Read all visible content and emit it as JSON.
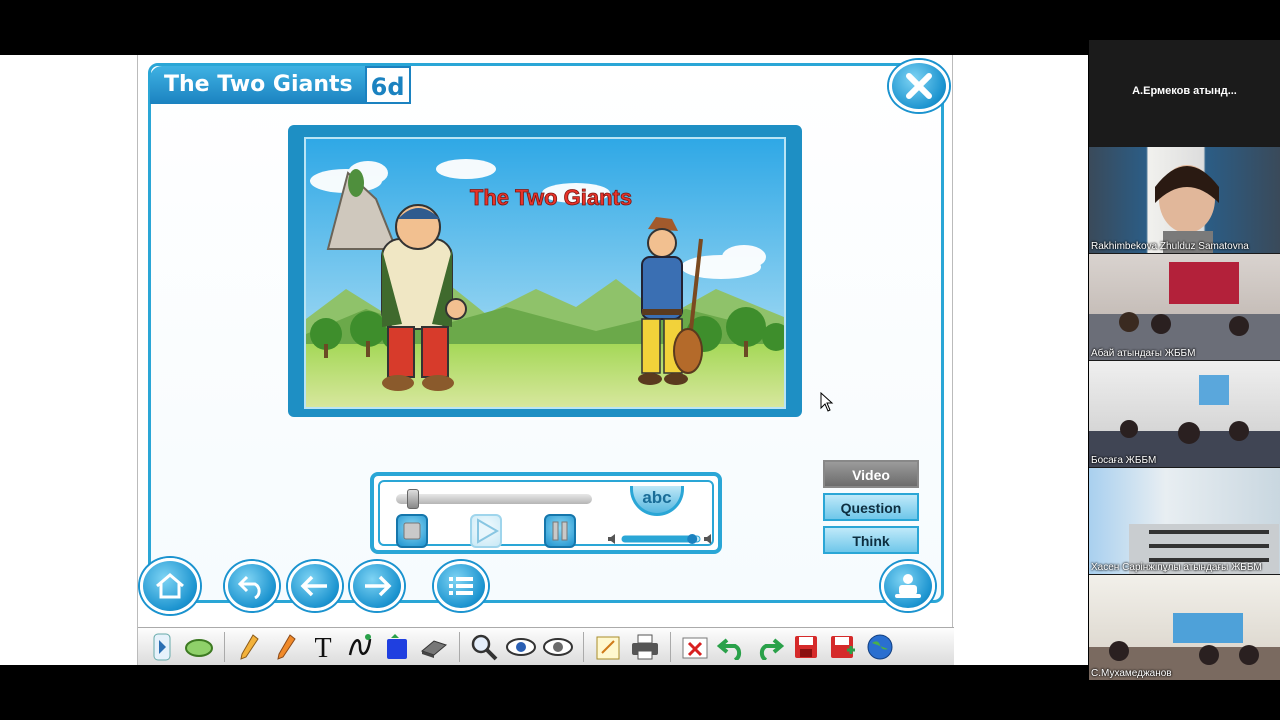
{
  "lesson": {
    "title": "The Two Giants",
    "unit": "6d"
  },
  "video": {
    "caption": "The Two Giants",
    "progress_fraction": 0.06,
    "volume_fraction": 0.9
  },
  "controls": {
    "abc_label": "abc"
  },
  "side_buttons": {
    "video": "Video",
    "question": "Question",
    "think": "Think"
  },
  "participants": {
    "host_name": "А.Ермеков  атынд...",
    "tiles": [
      {
        "label": "Rakhimbekova Zhulduz Samatovna"
      },
      {
        "label": "Абай атындағы ЖББМ"
      },
      {
        "label": "Босаға ЖББМ"
      },
      {
        "label": "Хасен Сарінжіпұлы атындағы ЖББМ"
      },
      {
        "label": "С.Мухамеджанов"
      }
    ]
  },
  "colors": {
    "accent": "#2aa6d6",
    "accent_dark": "#1b82c0",
    "title_text": "#ffffff",
    "caption_red": "#e8332a"
  },
  "icons": {
    "close": "close-icon",
    "home": "home-icon",
    "undo": "undo-icon",
    "back": "arrow-left-icon",
    "next": "arrow-right-icon",
    "list": "list-icon",
    "robot": "robot-icon"
  }
}
